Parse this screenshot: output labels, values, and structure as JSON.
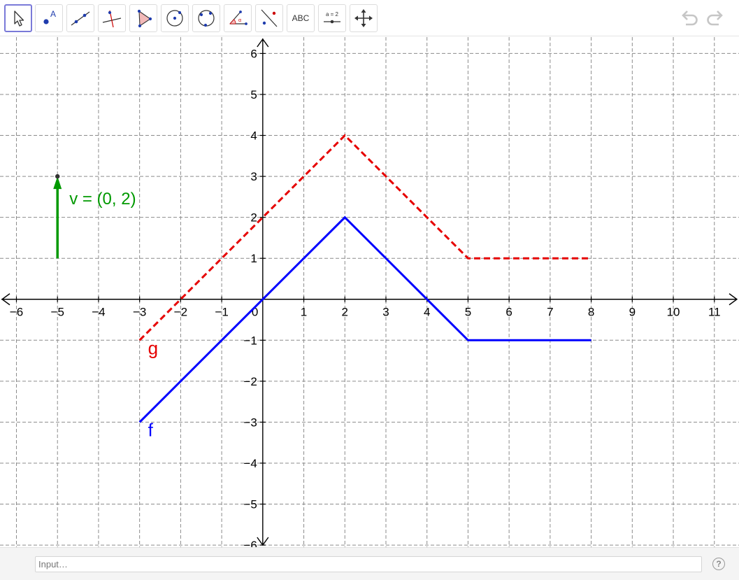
{
  "toolbar": {
    "tools": [
      {
        "name": "move-tool",
        "icon": "cursor-arrow-icon"
      },
      {
        "name": "point-tool",
        "icon": "point-icon"
      },
      {
        "name": "line-tool",
        "icon": "line-through-points-icon"
      },
      {
        "name": "perpendicular-tool",
        "icon": "perpendicular-line-icon"
      },
      {
        "name": "polygon-tool",
        "icon": "polygon-icon"
      },
      {
        "name": "circle-tool",
        "icon": "circle-center-point-icon"
      },
      {
        "name": "ellipse-tool",
        "icon": "circle-three-points-icon"
      },
      {
        "name": "angle-tool",
        "icon": "angle-icon"
      },
      {
        "name": "reflect-tool",
        "icon": "reflect-about-line-icon"
      },
      {
        "name": "text-tool",
        "label": "ABC"
      },
      {
        "name": "slider-tool",
        "label": "a = 2",
        "icon": "slider-icon"
      },
      {
        "name": "move-graphics-tool",
        "icon": "move-view-icon"
      }
    ],
    "undo_icon": "undo-icon",
    "redo_icon": "redo-icon"
  },
  "graph": {
    "x_ticks": [
      "-6",
      "-5",
      "-4",
      "-3",
      "-2",
      "-1",
      "0",
      "1",
      "2",
      "3",
      "4",
      "5",
      "6",
      "7",
      "8",
      "9",
      "10",
      "11"
    ],
    "y_ticks": [
      "6",
      "5",
      "4",
      "3",
      "2",
      "1",
      "-1",
      "-2",
      "-3",
      "-4",
      "-5",
      "-6"
    ],
    "xlim": [
      -6.4,
      11.6
    ],
    "ylim": [
      -6.05,
      6.4
    ],
    "grid": true,
    "grid_style": "dashed",
    "functions": [
      {
        "label": "f",
        "color": "#0000ff",
        "style": "solid",
        "points": [
          [
            -3,
            -3
          ],
          [
            2,
            2
          ],
          [
            5,
            -1
          ],
          [
            8,
            -1
          ]
        ]
      },
      {
        "label": "g",
        "color": "#e60000",
        "style": "dashed",
        "points": [
          [
            -3,
            -1
          ],
          [
            2,
            4
          ],
          [
            5,
            1
          ],
          [
            8,
            1
          ]
        ]
      }
    ],
    "vector": {
      "label": "v = (0, 2)",
      "color": "#009900",
      "from": [
        -5,
        1
      ],
      "to": [
        -5,
        3
      ]
    }
  },
  "input": {
    "placeholder": "Input…",
    "help_label": "?"
  }
}
